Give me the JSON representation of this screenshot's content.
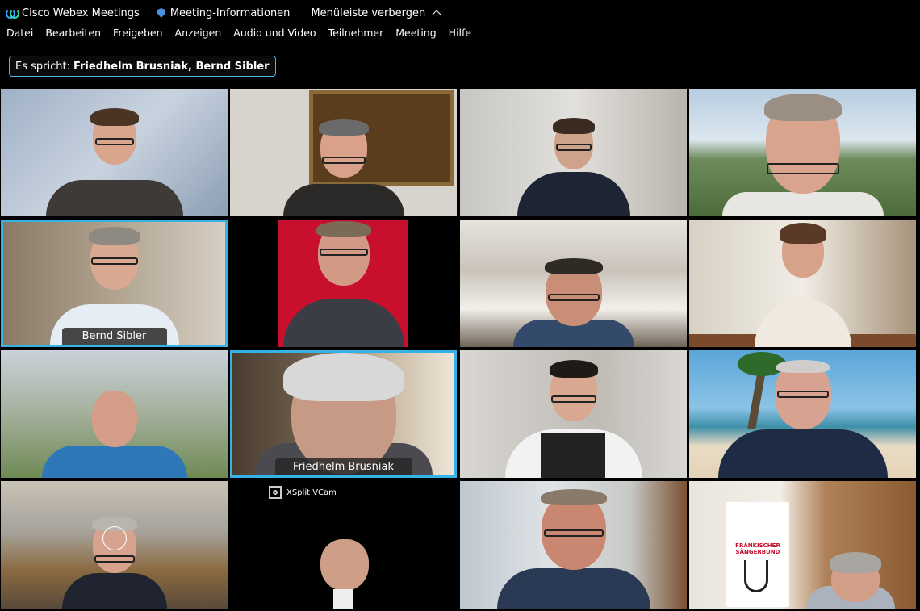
{
  "titlebar": {
    "app_name": "Cisco Webex Meetings",
    "app_icon": "webex-logo-icon",
    "meeting_info": "Meeting-Informationen",
    "hide_menubar": "Menüleiste verbergen"
  },
  "menubar": {
    "items": [
      "Datei",
      "Bearbeiten",
      "Freigeben",
      "Anzeigen",
      "Audio und Video",
      "Teilnehmer",
      "Meeting",
      "Hilfe"
    ]
  },
  "speaker": {
    "label": "Es spricht:",
    "names": "Friedhelm Brusniak, Bernd Sibler"
  },
  "tiles": [
    {
      "name": ""
    },
    {
      "name": ""
    },
    {
      "name": ""
    },
    {
      "name": ""
    },
    {
      "name": "Bernd Sibler"
    },
    {
      "name": ""
    },
    {
      "name": ""
    },
    {
      "name": ""
    },
    {
      "name": ""
    },
    {
      "name": "Friedhelm Brusniak"
    },
    {
      "name": ""
    },
    {
      "name": ""
    },
    {
      "name": ""
    },
    {
      "name": "XSplit VCam"
    },
    {
      "name": ""
    },
    {
      "name": ""
    }
  ],
  "banner": {
    "text": "FRÄNKISCHER SÄNGERBUND"
  },
  "colors": {
    "active_speaker_border": "#35b3e6",
    "background": "#000000"
  }
}
